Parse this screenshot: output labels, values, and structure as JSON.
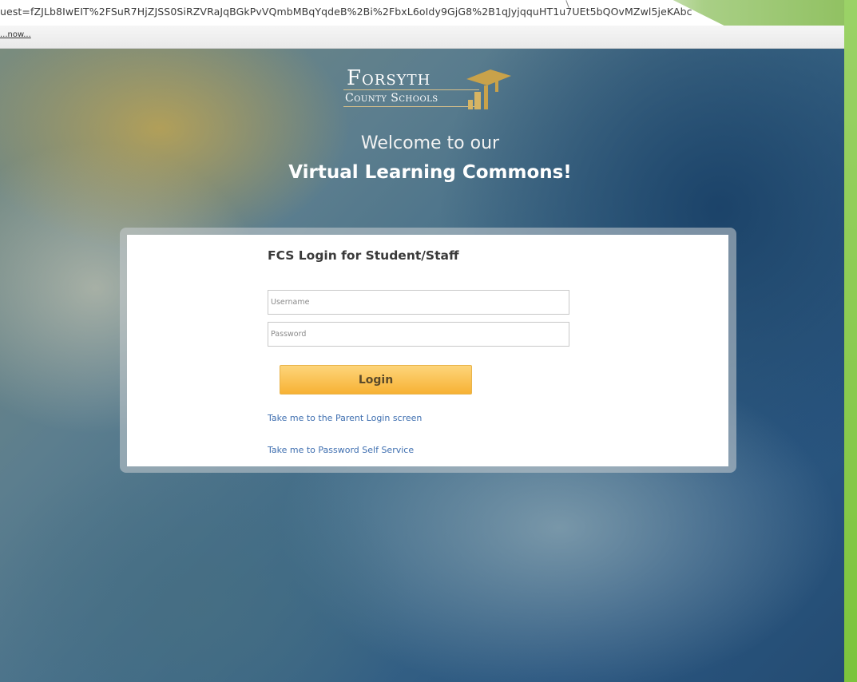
{
  "browser": {
    "url": "uest=fZJLb8IwEIT%2FSuR7HjZJSS0SiRZVRaJqBGkPvVQmbMBqYqdeB%2Bi%2FbxL6oIdy9GjG8%2B1qJyjqquHT1u7UEt5bQOvMZwl5jeKAbc",
    "notification_link": "...now..."
  },
  "logo": {
    "line1": "Forsyth",
    "line2": "County Schools"
  },
  "welcome": {
    "line1": "Welcome to our",
    "line2": "Virtual Learning Commons!"
  },
  "login": {
    "title": "FCS Login for Student/Staff",
    "username_placeholder": "Username",
    "username_value": "",
    "password_placeholder": "Password",
    "password_value": "",
    "login_button": "Login",
    "parent_link": "Take me to the Parent Login screen",
    "self_service_link": "Take me to Password Self Service"
  },
  "colors": {
    "accent_button": "#f7b234",
    "link": "#3f6fb0",
    "slide_green": "#8fc05f"
  }
}
